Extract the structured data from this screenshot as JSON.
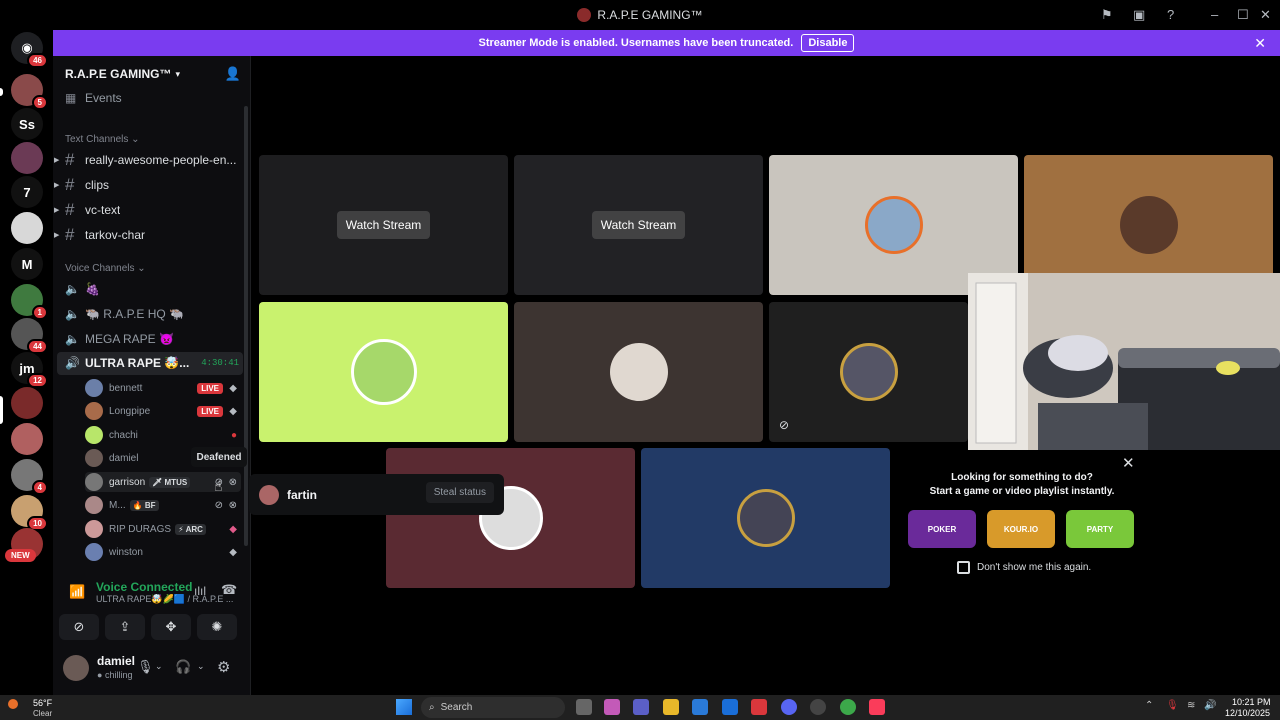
{
  "window": {
    "title": "R.A.P.E GAMING™"
  },
  "banner": {
    "text": "Streamer Mode is enabled. Usernames have been truncated.",
    "disable_label": "Disable",
    "close": "✕"
  },
  "rail": {
    "badges": [
      "46",
      "5",
      "1",
      "44",
      "12",
      "4",
      "10"
    ],
    "letters": [
      "Ss",
      "7",
      "M",
      "jm"
    ],
    "new_label": "NEW"
  },
  "server": {
    "name": "R.A.P.E GAMING™"
  },
  "sidebar": {
    "events_label": "Events",
    "text_category": "Text Channels",
    "text_channels": [
      "really-awesome-people-en...",
      "clips",
      "vc-text",
      "tarkov-char"
    ],
    "voice_category": "Voice Channels",
    "voice_channels": [
      {
        "name": "🍇"
      },
      {
        "name": "🐃 R.A.P.E HQ 🐃"
      },
      {
        "name": "MEGA RAPE 👿"
      },
      {
        "name": "ULTRA RAPE 🤯...",
        "timer": "4:30:41"
      }
    ],
    "voice_users": [
      {
        "name": "bennett",
        "live": "LIVE"
      },
      {
        "name": "Longpipe",
        "live": "LIVE"
      },
      {
        "name": "chachi"
      },
      {
        "name": "damiel"
      },
      {
        "name": "garrison",
        "tag": "🗡 MTUS"
      },
      {
        "name": "M...",
        "tag": "🔥 BF"
      },
      {
        "name": "RIP DURAGS",
        "tag": "⚡ ARC"
      },
      {
        "name": "winston"
      }
    ]
  },
  "tooltip": {
    "text": "Deafened"
  },
  "popup": {
    "name": "fartin",
    "action": "Steal status"
  },
  "voice_panel": {
    "status": "Voice Connected",
    "channel": "ULTRA RAPE🤯🌽🟦 / R.A.P.E ...",
    "user": {
      "name": "damiel",
      "status": "chilling"
    }
  },
  "tiles": {
    "watch_label": "Watch Stream"
  },
  "activity": {
    "title_line1": "Looking for something to do?",
    "title_line2": "Start a game or video playlist instantly.",
    "games": [
      "POKER",
      "KOUR.IO",
      "PARTY"
    ],
    "dont_show": "Don't show me this again."
  },
  "taskbar": {
    "weather_temp": "56°F",
    "weather_desc": "Clear",
    "search_label": "Search",
    "time": "10:21 PM",
    "date": "12/10/2025"
  },
  "colors": {
    "banner": "#7a3cf0",
    "live": "#da373c",
    "voice_green": "#23a55a"
  }
}
